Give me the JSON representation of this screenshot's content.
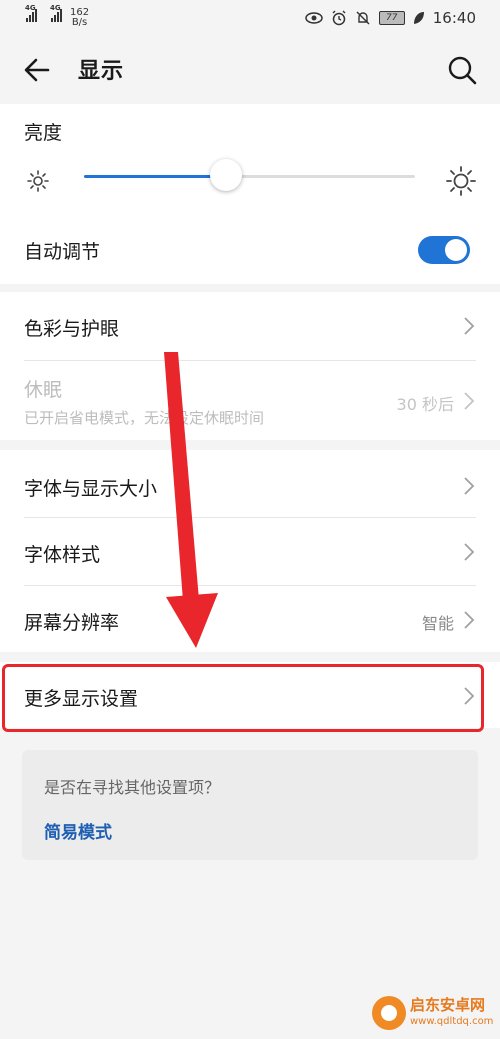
{
  "status_bar": {
    "net_type_1": "4G",
    "net_type_2": "4G",
    "speed_value": "162",
    "speed_unit": "B/s",
    "battery": "77",
    "time": "16:40"
  },
  "header": {
    "title": "显示"
  },
  "brightness": {
    "label": "亮度",
    "level": 0.43,
    "auto_label": "自动调节",
    "auto_enabled": true
  },
  "color_section": {
    "eye_label": "色彩与护眼",
    "sleep_label": "休眠",
    "sleep_sub": "已开启省电模式，无法设定休眠时间",
    "sleep_value": "30 秒后"
  },
  "font_section": {
    "font_size_label": "字体与显示大小",
    "font_style_label": "字体样式",
    "resolution_label": "屏幕分辨率",
    "resolution_value": "智能"
  },
  "more": {
    "label": "更多显示设置"
  },
  "suggestion": {
    "question": "是否在寻找其他设置项？",
    "link": "简易模式"
  },
  "watermark": {
    "brand": "启东安卓网",
    "url": "www.qdltdq.com"
  },
  "colors": {
    "accent": "#1f74d6",
    "highlight": "#e8262b"
  }
}
